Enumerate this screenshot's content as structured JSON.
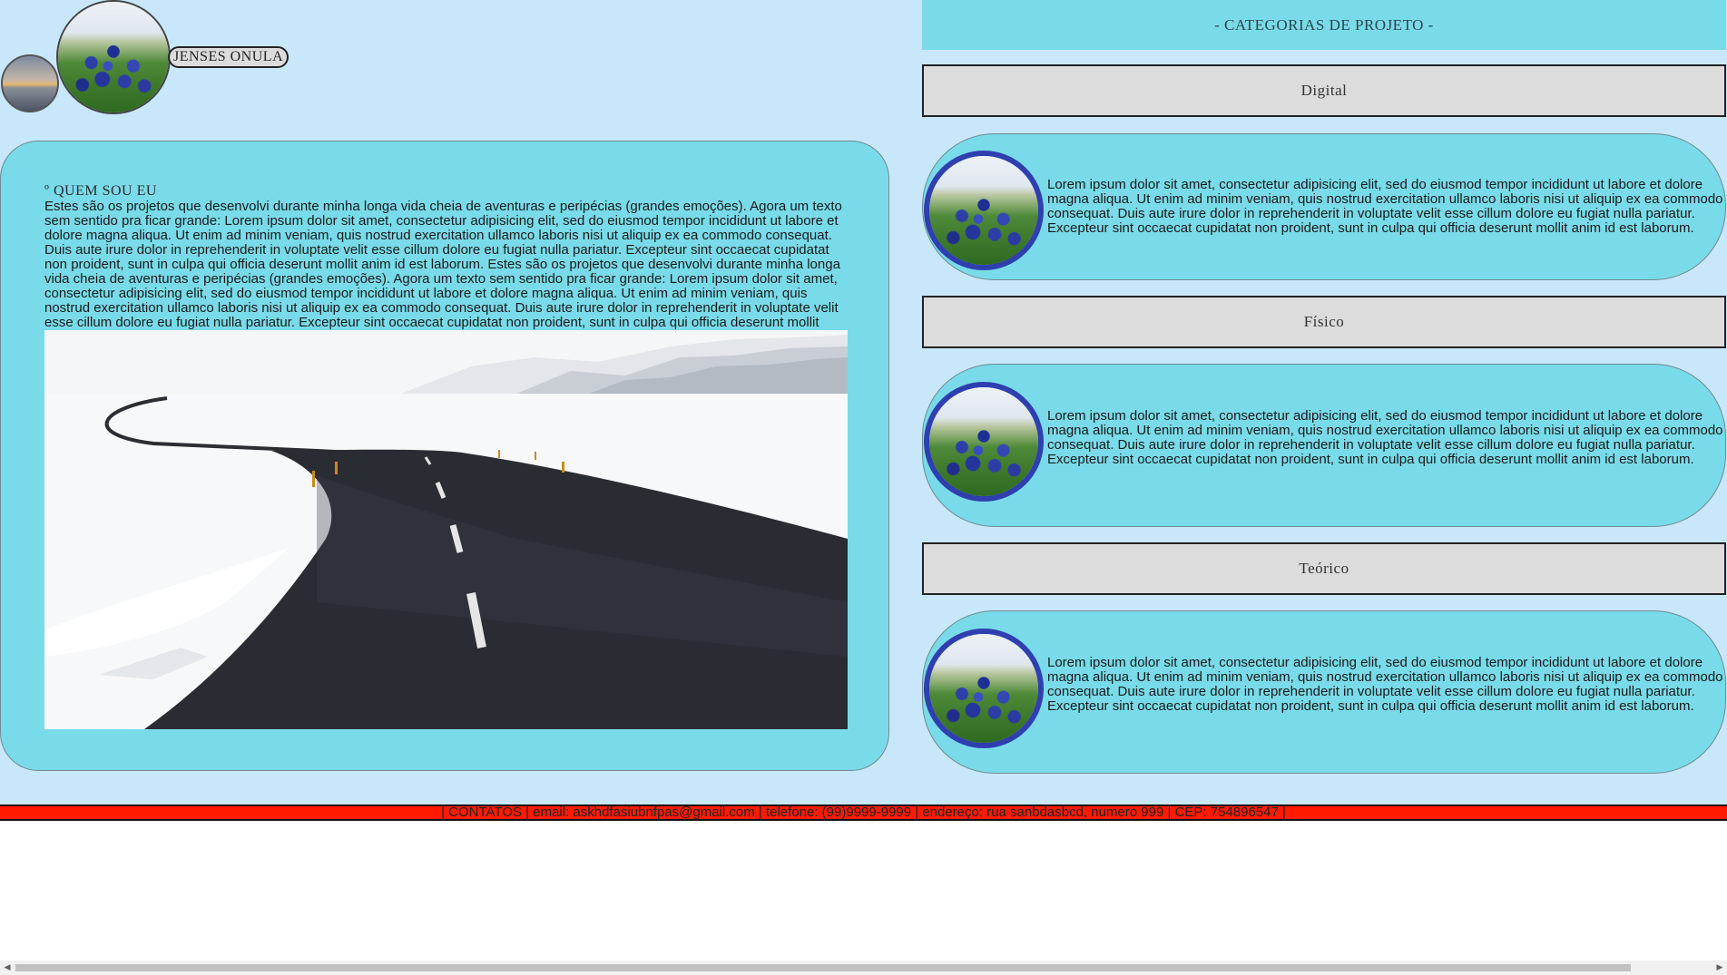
{
  "header": {
    "brand_name": "JENSES ONULA"
  },
  "about": {
    "title": "º QUEM SOU EU",
    "paragraph": "Estes são os projetos que desenvolvi durante minha longa vida cheia de aventuras e peripécias (grandes emoções). Agora um texto sem sentido pra ficar grande: Lorem ipsum dolor sit amet, consectetur adipisicing elit, sed do eiusmod tempor incididunt ut labore et dolore magna aliqua. Ut enim ad minim veniam, quis nostrud exercitation ullamco laboris nisi ut aliquip ex ea commodo consequat. Duis aute irure dolor in reprehenderit in voluptate velit esse cillum dolore eu fugiat nulla pariatur. Excepteur sint occaecat cupidatat non proident, sunt in culpa qui officia deserunt mollit anim id est laborum. Estes são os projetos que desenvolvi durante minha longa vida cheia de aventuras e peripécias (grandes emoções). Agora um texto sem sentido pra ficar grande: Lorem ipsum dolor sit amet, consectetur adipisicing elit, sed do eiusmod tempor incididunt ut labore et dolore magna aliqua. Ut enim ad minim veniam, quis nostrud exercitation ullamco laboris nisi ut aliquip ex ea commodo consequat. Duis aute irure dolor in reprehenderit in voluptate velit esse cillum dolore eu fugiat nulla pariatur. Excepteur sint occaecat cupidatat non proident, sunt in culpa qui officia deserunt mollit anim id est laborum. Aprecie :P"
  },
  "categories": {
    "header": "- CATEGORIAS DE PROJETO -",
    "items": [
      {
        "label": "Digital",
        "text": "Lorem ipsum dolor sit amet, consectetur adipisicing elit, sed do eiusmod tempor incididunt ut labore et dolore magna aliqua. Ut enim ad minim veniam, quis nostrud exercitation ullamco laboris nisi ut aliquip ex ea commodo consequat. Duis aute irure dolor in reprehenderit in voluptate velit esse cillum dolore eu fugiat nulla pariatur. Excepteur sint occaecat cupidatat non proident, sunt in culpa qui officia deserunt mollit anim id est laborum."
      },
      {
        "label": "Físico",
        "text": "Lorem ipsum dolor sit amet, consectetur adipisicing elit, sed do eiusmod tempor incididunt ut labore et dolore magna aliqua. Ut enim ad minim veniam, quis nostrud exercitation ullamco laboris nisi ut aliquip ex ea commodo consequat. Duis aute irure dolor in reprehenderit in voluptate velit esse cillum dolore eu fugiat nulla pariatur. Excepteur sint occaecat cupidatat non proident, sunt in culpa qui officia deserunt mollit anim id est laborum."
      },
      {
        "label": "Teórico",
        "text": "Lorem ipsum dolor sit amet, consectetur adipisicing elit, sed do eiusmod tempor incididunt ut labore et dolore magna aliqua. Ut enim ad minim veniam, quis nostrud exercitation ullamco laboris nisi ut aliquip ex ea commodo consequat. Duis aute irure dolor in reprehenderit in voluptate velit esse cillum dolore eu fugiat nulla pariatur. Excepteur sint occaecat cupidatat non proident, sunt in culpa qui officia deserunt mollit anim id est laborum."
      }
    ]
  },
  "footer": {
    "text": "| CONTATOS | email: askhdfasiubnfpas@gmail.com | telefone: (99)9999-9999 | endereço: rua sanbdasbcd, numero 999 | CEP: 754896547 |"
  },
  "scrollbar": {
    "left_arrow_icon": "chevron-left-icon",
    "right_arrow_icon": "chevron-right-icon"
  },
  "colors": {
    "page_bg": "#c9e7fb",
    "card_bg": "#79dbe9",
    "bar_bg": "#dcdcdc",
    "footer_bg": "#ff1a00",
    "image_ring": "#2f3fb0"
  }
}
